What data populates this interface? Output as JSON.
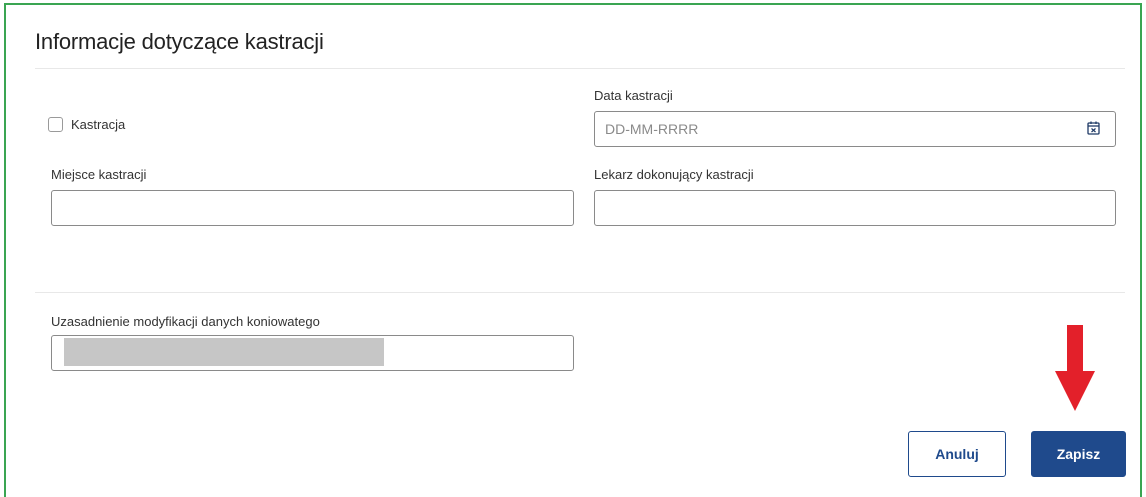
{
  "section": {
    "title": "Informacje dotyczące kastracji"
  },
  "castration": {
    "checkbox_label": "Kastracja",
    "checked": false
  },
  "castration_date": {
    "label": "Data kastracji",
    "placeholder": "DD-MM-RRRR",
    "value": ""
  },
  "castration_place": {
    "label": "Miejsce kastracji",
    "value": ""
  },
  "castration_vet": {
    "label": "Lekarz dokonujący kastracji",
    "value": ""
  },
  "justification": {
    "label": "Uzasadnienie modyfikacji danych koniowatego",
    "value": ""
  },
  "buttons": {
    "cancel_label": "Anuluj",
    "save_label": "Zapisz"
  },
  "colors": {
    "frame_border": "#3aa552",
    "primary": "#1f4a8c",
    "arrow": "#e3202a",
    "redaction": "#c6c6c6"
  },
  "icons": {
    "date_picker": "calendar-icon",
    "annotation": "red-arrow-down"
  }
}
